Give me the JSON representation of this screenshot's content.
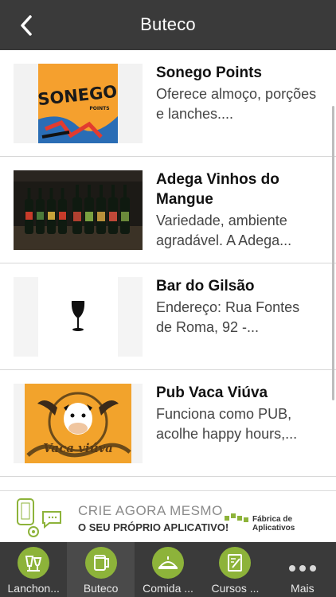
{
  "header": {
    "title": "Buteco"
  },
  "items": [
    {
      "title": "Sonego Points",
      "description": "Oferece almoço, porções e lanches....",
      "thumb": "sonego-points-logo",
      "logo_text": "SONEGO",
      "logo_sub": "POINTS"
    },
    {
      "title": "Adega Vinhos do Mangue",
      "description": "Variedade, ambiente agradável. A Adega...",
      "thumb": "wine-bottles-photo"
    },
    {
      "title": "Bar do Gilsão",
      "description": "Endereço: Rua Fontes de Roma, 92 -...",
      "thumb": "wine-glass-icon"
    },
    {
      "title": "Pub Vaca Viúva",
      "description": "Funciona como PUB, acolhe happy hours,...",
      "thumb": "vaca-viuva-logo",
      "logo_text": "Vaca viúva"
    }
  ],
  "banner": {
    "line1": "CRIE AGORA MESMO",
    "line2": "O SEU PRÓPRIO APLICATIVO!",
    "brand": "Fábrica de Aplicativos"
  },
  "tabs": [
    {
      "label": "Lanchon...",
      "icon": "drinks-icon"
    },
    {
      "label": "Buteco",
      "icon": "mug-icon",
      "active": true
    },
    {
      "label": "Comida ...",
      "icon": "food-icon"
    },
    {
      "label": "Cursos ...",
      "icon": "pencil-note-icon"
    },
    {
      "label": "Mais",
      "icon": "more-icon"
    }
  ],
  "colors": {
    "accent": "#8db33a",
    "bar": "#3a3a3a"
  }
}
